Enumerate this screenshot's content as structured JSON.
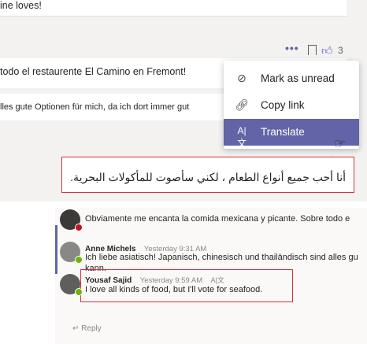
{
  "top": {
    "message1_text": "ine loves!",
    "reactions": {
      "more": "•••",
      "like_count": "3"
    },
    "message2_text": "todo el restaurente El Camino en Fremont!",
    "message3_text": "lles gute Optionen für mich, da ich dort immer gut",
    "context_menu": [
      {
        "icon": "mark-unread-icon",
        "label": "Mark as unread"
      },
      {
        "icon": "link-icon",
        "label": "Copy link"
      },
      {
        "icon": "translate-icon",
        "label": "Translate"
      }
    ],
    "reply_like_count": "3",
    "arabic_text": "أنا أحب جميع أنواع الطعام ، لكني سأصوت للمأكولات البحرية."
  },
  "bottom": {
    "row0_text": "Obviamente me encanta la comida mexicana y picante. Sobre todo e",
    "anne": {
      "name": "Anne Michels",
      "time": "Yesterday 9:31 AM",
      "text": "Ich liebe asiatisch! Japanisch, chinesisch und thailändisch sind alles gu kann."
    },
    "yousaf": {
      "name": "Yousaf Sajid",
      "time": "Yesterday 9:59 AM",
      "translated_mark": "A|文",
      "text": "I love all kinds of food, but I'll vote for seafood."
    },
    "reply_label": "Reply"
  }
}
